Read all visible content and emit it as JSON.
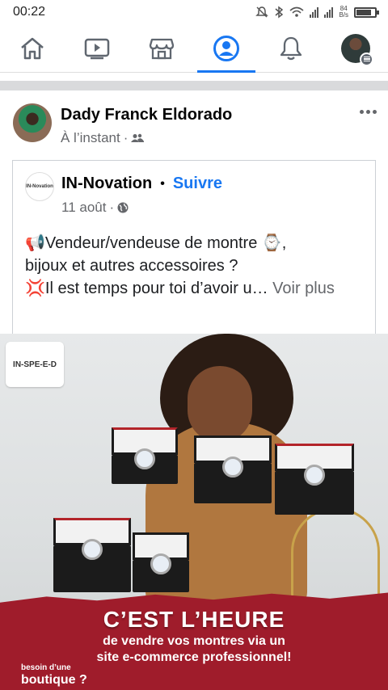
{
  "status_bar": {
    "time": "00:22",
    "net_speed_value": "84",
    "net_speed_unit": "B/s",
    "icons": [
      "mute-icon",
      "bluetooth-icon",
      "wifi-icon",
      "signal-icon",
      "signal-icon",
      "battery-icon"
    ],
    "battery_level": 0.8
  },
  "nav": {
    "items": [
      "home-icon",
      "watch-icon",
      "marketplace-icon",
      "groups-icon",
      "notifications-icon",
      "profile-menu"
    ],
    "active": "groups-icon",
    "accent": "#1877f2"
  },
  "post": {
    "author": "Dady Franck Eldorado",
    "time": "À l’instant",
    "audience_icon": "friends-icon",
    "shared": {
      "page_logo_text": "IN-Novation",
      "page_name": "IN-Novation",
      "separator": "•",
      "follow_label": "Suivre",
      "date": "11 août",
      "audience_icon": "globe-icon",
      "text_line1": "📢Vendeur/vendeuse de montre ⌚,",
      "text_line2": "bijoux et autres accessoires ?",
      "text_line3": "💢Il est temps pour toi d’avoir u…",
      "see_more": "Voir plus"
    },
    "image": {
      "logo_text": "IN-SPE-E-D",
      "headline": "C’EST L’HEURE",
      "subline1": "de vendre vos montres via un",
      "subline2": "site e-commerce professionnel!",
      "besoin_line1": "besoin d’une",
      "boutique": "boutique ?"
    }
  }
}
